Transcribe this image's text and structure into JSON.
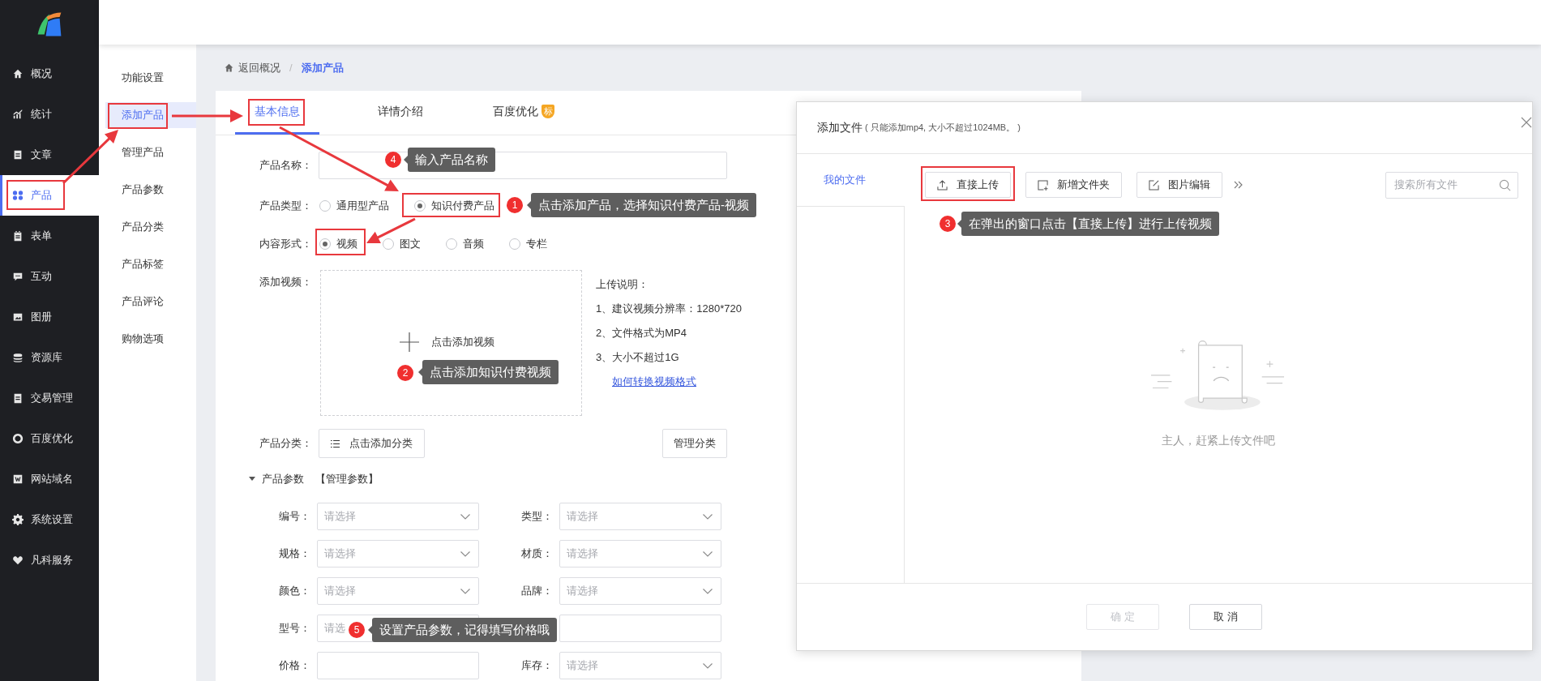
{
  "sidebar": {
    "items": [
      {
        "label": "概况",
        "selected": false
      },
      {
        "label": "统计",
        "selected": false
      },
      {
        "label": "文章",
        "selected": false
      },
      {
        "label": "产品",
        "selected": true
      },
      {
        "label": "表单",
        "selected": false
      },
      {
        "label": "互动",
        "selected": false
      },
      {
        "label": "图册",
        "selected": false
      },
      {
        "label": "资源库",
        "selected": false
      },
      {
        "label": "交易管理",
        "selected": false
      },
      {
        "label": "百度优化",
        "selected": false
      },
      {
        "label": "网站域名",
        "selected": false
      },
      {
        "label": "系统设置",
        "selected": false
      },
      {
        "label": "凡科服务",
        "selected": false
      }
    ]
  },
  "subnav": {
    "items": [
      {
        "label": "功能设置",
        "selected": false
      },
      {
        "label": "添加产品",
        "selected": true
      },
      {
        "label": "管理产品",
        "selected": false
      },
      {
        "label": "产品参数",
        "selected": false
      },
      {
        "label": "产品分类",
        "selected": false
      },
      {
        "label": "产品标签",
        "selected": false
      },
      {
        "label": "产品评论",
        "selected": false
      },
      {
        "label": "购物选项",
        "selected": false
      }
    ]
  },
  "breadcrumb": {
    "back": "返回概况",
    "separator": "/",
    "current": "添加产品"
  },
  "tabs": [
    {
      "label": "基本信息",
      "selected": true
    },
    {
      "label": "详情介绍",
      "selected": false
    },
    {
      "label": "百度优化",
      "selected": false,
      "badge": "标"
    }
  ],
  "form": {
    "name": {
      "label": "产品名称："
    },
    "type": {
      "label": "产品类型：",
      "options": [
        {
          "label": "通用型产品",
          "selected": false
        },
        {
          "label": "知识付费产品",
          "selected": true
        }
      ]
    },
    "content": {
      "label": "内容形式：",
      "options": [
        {
          "label": "视频",
          "selected": true
        },
        {
          "label": "图文",
          "selected": false
        },
        {
          "label": "音频",
          "selected": false
        },
        {
          "label": "专栏",
          "selected": false
        }
      ]
    },
    "video": {
      "label": "添加视频：",
      "add": "点击添加视频",
      "notes_title": "上传说明：",
      "notes": [
        "1、建议视频分辨率：1280*720",
        "2、文件格式为MP4",
        "3、大小不超过1G"
      ],
      "link": "如何转换视频格式"
    },
    "category": {
      "label": "产品分类：",
      "add": "点击添加分类",
      "manage": "管理分类"
    },
    "params": {
      "title": "产品参数",
      "manage": "【管理参数】",
      "expanded": true,
      "fields": [
        {
          "label": "编号：",
          "placeholder": "请选择",
          "kind": "select"
        },
        {
          "label": "类型：",
          "placeholder": "请选择",
          "kind": "select"
        },
        {
          "label": "规格：",
          "placeholder": "请选择",
          "kind": "select"
        },
        {
          "label": "材质：",
          "placeholder": "请选择",
          "kind": "select"
        },
        {
          "label": "颜色：",
          "placeholder": "请选择",
          "kind": "select"
        },
        {
          "label": "品牌：",
          "placeholder": "请选择",
          "kind": "select"
        },
        {
          "label": "型号：",
          "placeholder": "请选",
          "kind": "input"
        },
        {
          "kind": "input"
        },
        {
          "label": "价格：",
          "kind": "input"
        },
        {
          "label": "库存：",
          "placeholder": "请选择",
          "kind": "select"
        }
      ]
    }
  },
  "dialog": {
    "title": "添加文件",
    "hint": "( 只能添加mp4, 大小不超过1024MB。 )",
    "folders": [
      {
        "label": "我的文件",
        "selected": true
      }
    ],
    "toolbar": [
      {
        "label": "直接上传",
        "kind": "upload"
      },
      {
        "label": "新增文件夹",
        "kind": "folder"
      },
      {
        "label": "图片编辑",
        "kind": "edit"
      }
    ],
    "search": {
      "placeholder": "搜索所有文件"
    },
    "empty": "主人，赶紧上传文件吧",
    "buttons": [
      {
        "label": "确 定",
        "disabled": true
      },
      {
        "label": "取 消",
        "disabled": false
      }
    ]
  },
  "annotations": [
    {
      "number": "1",
      "text": "点击添加产品，选择知识付费产品-视频"
    },
    {
      "number": "2",
      "text": "点击添加知识付费视频"
    },
    {
      "number": "3",
      "text": "在弹出的窗口点击【直接上传】进行上传视频"
    },
    {
      "number": "4",
      "text": "输入产品名称"
    },
    {
      "number": "5",
      "text": "设置产品参数，记得填写价格哦"
    }
  ]
}
